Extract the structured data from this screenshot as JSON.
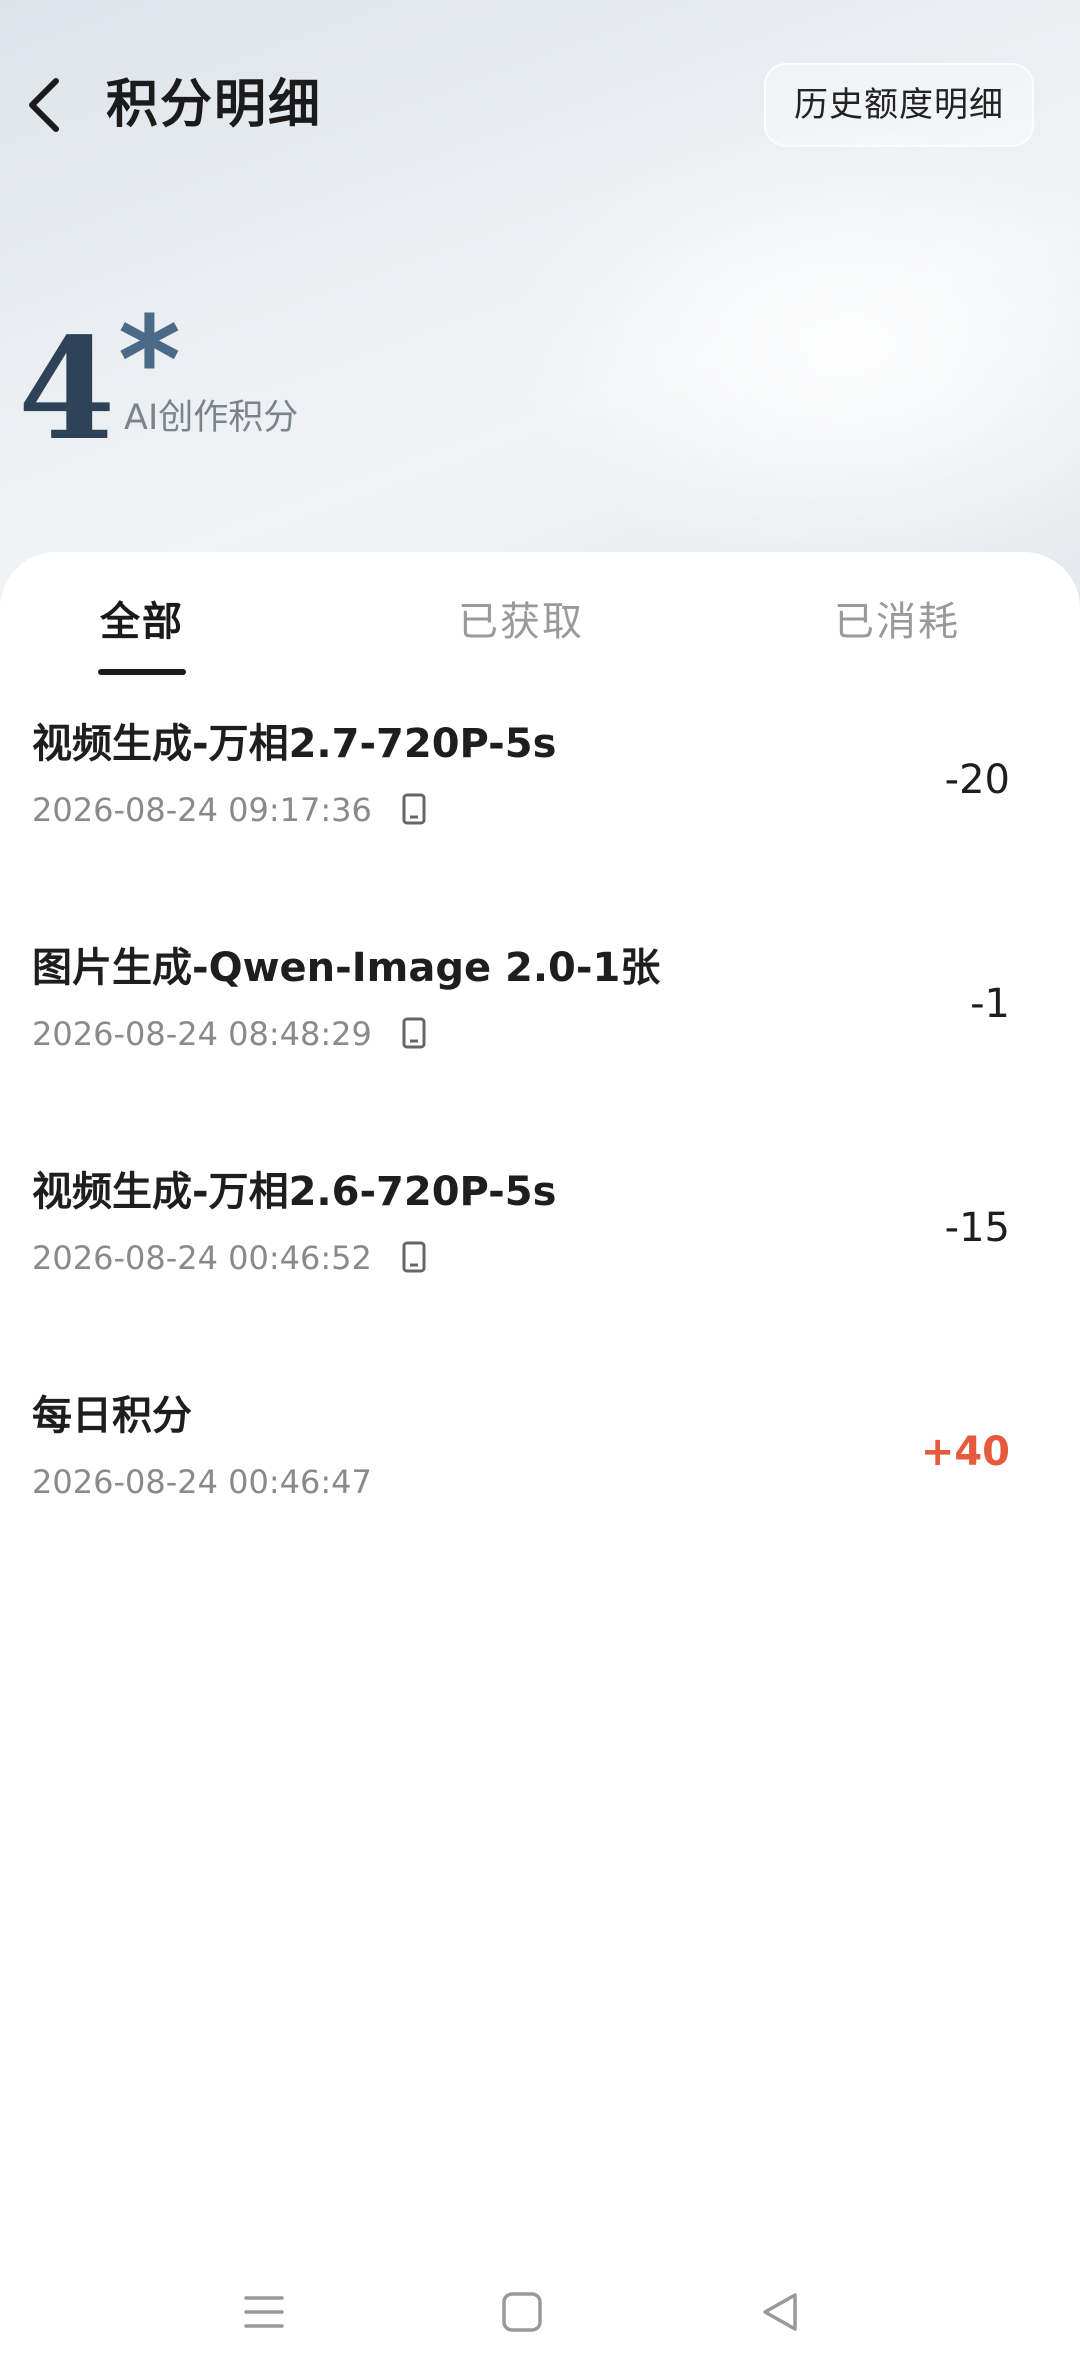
{
  "header": {
    "title": "积分明细",
    "history_button": "历史额度明细"
  },
  "points": {
    "value": "4",
    "asterisk": "*",
    "label": "AI创作积分"
  },
  "tabs": [
    {
      "label": "全部",
      "active": true
    },
    {
      "label": "已获取",
      "active": false
    },
    {
      "label": "已消耗",
      "active": false
    }
  ],
  "records": [
    {
      "title": "视频生成-万相2.7-720P-5s",
      "time": "2026-08-24 09:17:36",
      "device_icon": "phone-icon",
      "amount": "-20"
    },
    {
      "title": "图片生成-Qwen-Image 2.0-1张",
      "time": "2026-08-24 08:48:29",
      "device_icon": "phone-icon",
      "amount": "-1"
    },
    {
      "title": "视频生成-万相2.6-720P-5s",
      "time": "2026-08-24 00:46:52",
      "device_icon": "phone-icon",
      "amount": "-15"
    },
    {
      "title": "每日积分",
      "time": "2026-08-24 00:46:47",
      "device_icon": "",
      "amount": "+40"
    }
  ],
  "colors": {
    "positive": "#e65a3e",
    "text_primary": "#1e1e1e",
    "text_secondary": "#8a8a8a",
    "points_value": "#2f4358"
  },
  "nav": {
    "menu_icon": "menu-icon",
    "home_icon": "home-icon",
    "back_icon": "back-triangle-icon"
  }
}
